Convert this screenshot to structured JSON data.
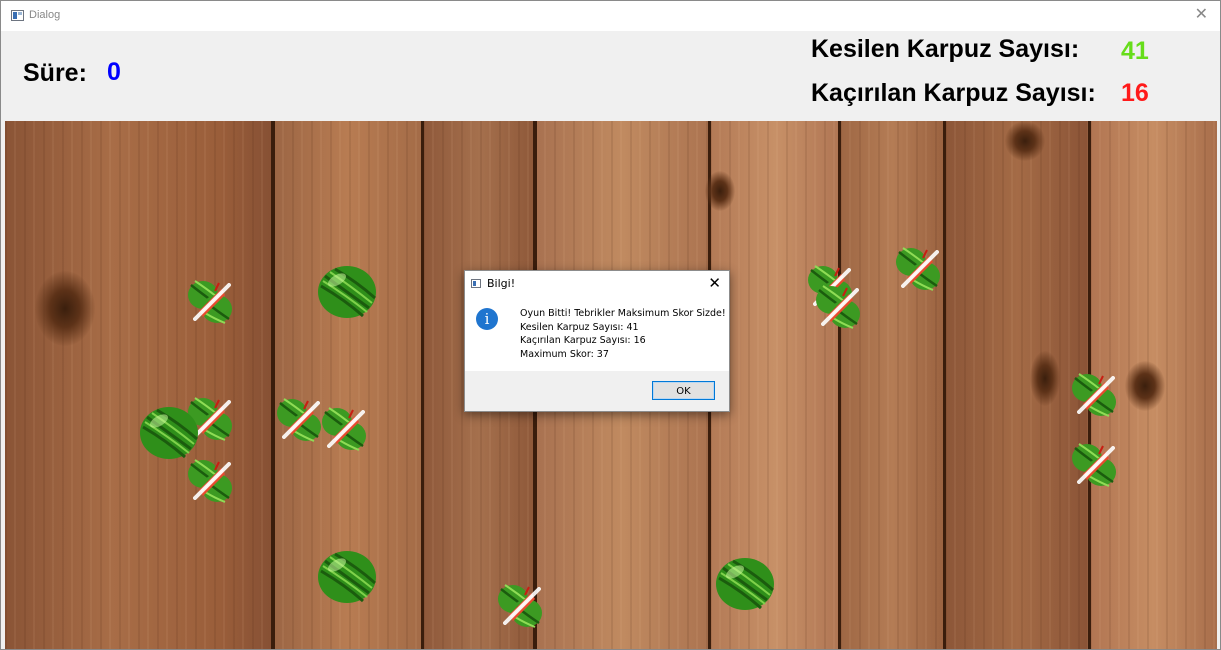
{
  "window": {
    "title": "Dialog",
    "close_glyph": "✕"
  },
  "hud": {
    "time_label": "Süre:",
    "time_value": "0",
    "cut_label": "Kesilen Karpuz Sayısı:",
    "cut_value": "41",
    "missed_label": "Kaçırılan Karpuz Sayısı:",
    "missed_value": "16",
    "colors": {
      "time": "#0000ff",
      "cut": "#66dd1a",
      "missed": "#ff1a1a"
    }
  },
  "dialog": {
    "title": "Bilgi!",
    "close_glyph": "✕",
    "icon": "info-icon",
    "icon_glyph": "i",
    "lines": [
      "Oyun Bitti! Tebrikler Maksimum Skor Sizde!",
      "Kesilen Karpuz Sayısı: 41",
      "Kaçırılan Karpuz Sayısı: 16",
      "Maximum Skor: 37"
    ],
    "ok_label": "OK"
  },
  "game": {
    "background": "wooden-planks",
    "watermelons": [
      {
        "state": "sliced"
      },
      {
        "state": "whole"
      },
      {
        "state": "sliced"
      },
      {
        "state": "sliced"
      },
      {
        "state": "whole"
      },
      {
        "state": "sliced"
      },
      {
        "state": "sliced"
      },
      {
        "state": "sliced"
      },
      {
        "state": "sliced"
      },
      {
        "state": "sliced"
      },
      {
        "state": "sliced"
      },
      {
        "state": "sliced"
      },
      {
        "state": "whole"
      },
      {
        "state": "sliced"
      },
      {
        "state": "whole"
      }
    ]
  }
}
